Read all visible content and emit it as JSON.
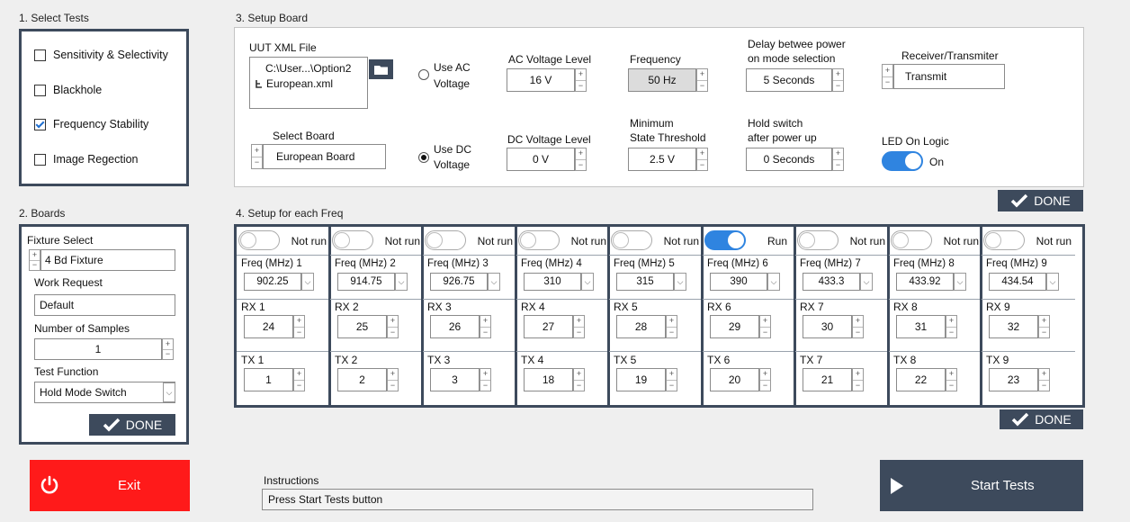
{
  "sections": {
    "select_tests": "1. Select Tests",
    "boards": "2. Boards",
    "setup_board": "3. Setup Board",
    "setup_freq": "4. Setup for each Freq"
  },
  "tests": [
    {
      "label": "Sensitivity & Selectivity",
      "checked": false
    },
    {
      "label": "Blackhole",
      "checked": false
    },
    {
      "label": "Frequency Stability",
      "checked": true
    },
    {
      "label": "Image Regection",
      "checked": false
    }
  ],
  "boards": {
    "fixture_label": "Fixture Select",
    "fixture_value": "4 Bd Fixture",
    "work_request_label": "Work Request",
    "work_request_value": "Default",
    "samples_label": "Number of Samples",
    "samples_value": "1",
    "test_function_label": "Test Function",
    "test_function_value": "Hold Mode Switch",
    "done": "DONE"
  },
  "setup": {
    "uut_label": "UUT XML File",
    "uut_line1": "C:\\User...\\Option2",
    "uut_line2": "European.xml",
    "use_ac": "Use AC\nVoltage",
    "use_ac_1": "Use AC",
    "use_ac_2": "Voltage",
    "use_dc_1": "Use DC",
    "use_dc_2": "Voltage",
    "ac_label": "AC Voltage Level",
    "ac_value": "16 V",
    "freq_label": "Frequency",
    "freq_value": "50 Hz",
    "delay_label_1": "Delay betwee power",
    "delay_label_2": "on mode selection",
    "delay_value": "5 Seconds",
    "rxtx_label": "Receiver/Transmiter",
    "rxtx_value": "Transmit",
    "board_label": "Select Board",
    "board_value": "European Board",
    "dc_label": "DC Voltage Level",
    "dc_value": "0 V",
    "thresh_label_1": "Minimum",
    "thresh_label_2": "State Threshold",
    "thresh_value": "2.5 V",
    "hold_label_1": "Hold switch",
    "hold_label_2": "after power up",
    "hold_value": "0 Seconds",
    "led_label": "LED On Logic",
    "led_value": "On",
    "done": "DONE"
  },
  "freqs": [
    {
      "run": "Not run",
      "on": false,
      "flabel": "Freq (MHz) 1",
      "fval": "902.25",
      "rxl": "RX 1",
      "rx": "24",
      "txl": "TX 1",
      "tx": "1"
    },
    {
      "run": "Not run",
      "on": false,
      "flabel": "Freq (MHz) 2",
      "fval": "914.75",
      "rxl": "RX 2",
      "rx": "25",
      "txl": "TX 2",
      "tx": "2"
    },
    {
      "run": "Not run",
      "on": false,
      "flabel": "Freq (MHz) 3",
      "fval": "926.75",
      "rxl": "RX 3",
      "rx": "26",
      "txl": "TX 3",
      "tx": "3"
    },
    {
      "run": "Not run",
      "on": false,
      "flabel": "Freq (MHz) 4",
      "fval": "310",
      "rxl": "RX 4",
      "rx": "27",
      "txl": "TX 4",
      "tx": "18"
    },
    {
      "run": "Not run",
      "on": false,
      "flabel": "Freq (MHz) 5",
      "fval": "315",
      "rxl": "RX 5",
      "rx": "28",
      "txl": "TX 5",
      "tx": "19"
    },
    {
      "run": "Run",
      "on": true,
      "flabel": "Freq (MHz) 6",
      "fval": "390",
      "rxl": "RX 6",
      "rx": "29",
      "txl": "TX 6",
      "tx": "20"
    },
    {
      "run": "Not run",
      "on": false,
      "flabel": "Freq (MHz) 7",
      "fval": "433.3",
      "rxl": "RX 7",
      "rx": "30",
      "txl": "TX 7",
      "tx": "21"
    },
    {
      "run": "Not run",
      "on": false,
      "flabel": "Freq (MHz) 8",
      "fval": "433.92",
      "rxl": "RX 8",
      "rx": "31",
      "txl": "TX 8",
      "tx": "22"
    },
    {
      "run": "Not run",
      "on": false,
      "flabel": "Freq (MHz) 9",
      "fval": "434.54",
      "rxl": "RX 9",
      "rx": "32",
      "txl": "TX 9",
      "tx": "23"
    }
  ],
  "freq_done": "DONE",
  "exit_label": "Exit",
  "instructions_label": "Instructions",
  "instructions_text": "Press Start Tests button",
  "start_label": "Start Tests",
  "colors": {
    "navy": "#3d4a5c",
    "exit_red": "#ff1a1a",
    "toggle_blue": "#2f84e0"
  }
}
